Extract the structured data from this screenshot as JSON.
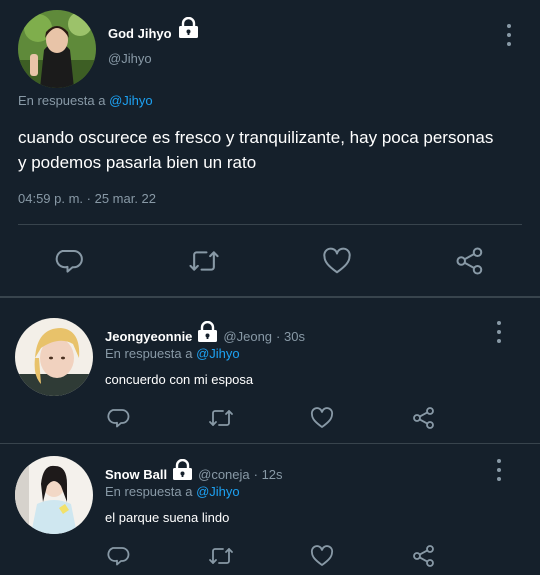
{
  "main_tweet": {
    "name": "God Jihyo",
    "handle": "@Jihyo",
    "reply_prefix": "En respuesta a",
    "reply_to": "@Jihyo",
    "text_line1": "cuando oscurece es fresco y tranquilizante, hay poca personas",
    "text_line2": "y podemos pasarla bien un rato",
    "timestamp": "04:59 p. m. · 25 mar. 22"
  },
  "replies": [
    {
      "name": "Jeongyeonnie",
      "handle": "@Jeong",
      "time": "· 30s",
      "reply_prefix": "En respuesta a",
      "reply_to": "@Jihyo",
      "text": "concuerdo con mi esposa"
    },
    {
      "name": "Snow Ball",
      "handle": "@coneja",
      "time": "· 12s",
      "reply_prefix": "En respuesta a",
      "reply_to": "@Jihyo",
      "text": "el parque suena lindo"
    }
  ],
  "colors": {
    "background": "#15202b",
    "muted": "#8899a6",
    "link": "#1da1f2",
    "divider": "#38444d"
  },
  "icons": [
    "lock-icon",
    "more-options-icon",
    "reply-icon",
    "retweet-icon",
    "like-icon",
    "share-icon"
  ]
}
